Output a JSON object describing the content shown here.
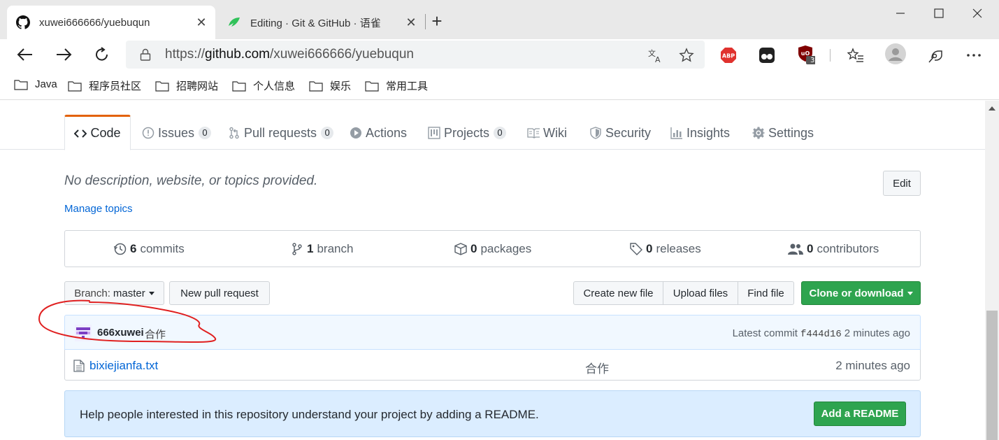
{
  "browser": {
    "tabs": [
      {
        "title": "xuwei666666/yuebuqun",
        "icon": "github-icon",
        "active": true
      },
      {
        "title": "Editing · Git & GitHub · 语雀",
        "icon": "yuque-icon",
        "active": false
      }
    ],
    "url_prefix": "https://",
    "url_host": "github.com",
    "url_path": "/xuwei666666/yuebuqun",
    "ublock_badge": "3",
    "bookmarks": [
      "Java",
      "程序员社区",
      "招聘网站",
      "个人信息",
      "娱乐",
      "常用工具"
    ]
  },
  "repo_nav": {
    "code": "Code",
    "issues": "Issues",
    "issues_count": "0",
    "pulls": "Pull requests",
    "pulls_count": "0",
    "actions": "Actions",
    "projects": "Projects",
    "projects_count": "0",
    "wiki": "Wiki",
    "security": "Security",
    "insights": "Insights",
    "settings": "Settings"
  },
  "repo": {
    "description": "No description, website, or topics provided.",
    "edit_label": "Edit",
    "manage_topics": "Manage topics"
  },
  "summary": {
    "commits_count": "6",
    "commits_label": "commits",
    "branch_count": "1",
    "branch_label": "branch",
    "packages_count": "0",
    "packages_label": "packages",
    "releases_count": "0",
    "releases_label": "releases",
    "contributors_count": "0",
    "contributors_label": "contributors"
  },
  "file_nav": {
    "branch_prefix": "Branch:",
    "branch_name": "master",
    "new_pr": "New pull request",
    "create_file": "Create new file",
    "upload_files": "Upload files",
    "find_file": "Find file",
    "clone": "Clone or download"
  },
  "commit": {
    "author": "666xuwei",
    "message": "合作",
    "latest_label": "Latest commit",
    "sha": "f444d16",
    "age": "2 minutes ago"
  },
  "files": [
    {
      "name": "bixiejianfa.txt",
      "message": "合作",
      "age": "2 minutes ago"
    }
  ],
  "readme_banner": {
    "text": "Help people interested in this repository understand your project by adding a README.",
    "button": "Add a README"
  },
  "colors": {
    "accent_orange": "#e36209",
    "link_blue": "#0366d6",
    "green_button": "#2ea44f",
    "annotation_red": "#e02020"
  }
}
